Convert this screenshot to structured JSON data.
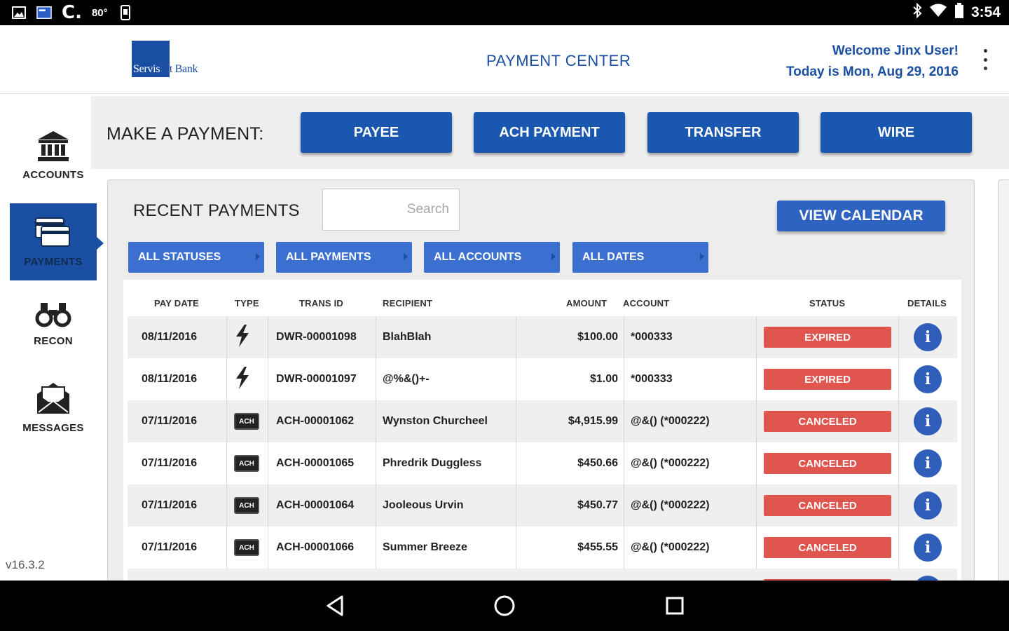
{
  "status_bar": {
    "carrier": "C.",
    "temp": "80°",
    "time": "3:54"
  },
  "header": {
    "logo": {
      "part1": "Servis",
      "part2": "1st Bank"
    },
    "title": "PAYMENT CENTER",
    "welcome": "Welcome Jinx User!",
    "date": "Today is Mon, Aug 29, 2016"
  },
  "sidebar": {
    "items": [
      {
        "label": "ACCOUNTS",
        "icon": "bank-icon"
      },
      {
        "label": "PAYMENTS",
        "icon": "payments-icon",
        "active": true
      },
      {
        "label": "RECON",
        "icon": "binoculars-icon"
      },
      {
        "label": "MESSAGES",
        "icon": "envelope-icon"
      }
    ],
    "version": "v16.3.2"
  },
  "make_payment": {
    "label": "MAKE A PAYMENT:",
    "buttons": [
      "PAYEE",
      "ACH PAYMENT",
      "TRANSFER",
      "WIRE"
    ]
  },
  "recent": {
    "title": "RECENT PAYMENTS",
    "search_placeholder": "Search",
    "view_calendar": "VIEW CALENDAR",
    "filters": [
      "ALL STATUSES",
      "ALL PAYMENTS",
      "ALL ACCOUNTS",
      "ALL DATES"
    ],
    "columns": [
      "PAY DATE",
      "TYPE",
      "TRANS ID",
      "RECIPIENT",
      "AMOUNT",
      "ACCOUNT",
      "STATUS",
      "DETAILS"
    ],
    "rows": [
      {
        "date": "08/11/2016",
        "type": "wire",
        "trans_id": "DWR-00001098",
        "recipient": "BlahBlah",
        "amount": "$100.00",
        "account": "*000333",
        "status": "EXPIRED"
      },
      {
        "date": "08/11/2016",
        "type": "wire",
        "trans_id": "DWR-00001097",
        "recipient": "@%&()+-",
        "amount": "$1.00",
        "account": "*000333",
        "status": "EXPIRED"
      },
      {
        "date": "07/11/2016",
        "type": "ACH",
        "trans_id": "ACH-00001062",
        "recipient": "Wynston Churcheel",
        "amount": "$4,915.99",
        "account": "@&() (*000222)",
        "status": "CANCELED"
      },
      {
        "date": "07/11/2016",
        "type": "ACH",
        "trans_id": "ACH-00001065",
        "recipient": "Phredrik Duggless",
        "amount": "$450.66",
        "account": "@&() (*000222)",
        "status": "CANCELED"
      },
      {
        "date": "07/11/2016",
        "type": "ACH",
        "trans_id": "ACH-00001064",
        "recipient": "Jooleous Urvin",
        "amount": "$450.77",
        "account": "@&() (*000222)",
        "status": "CANCELED"
      },
      {
        "date": "07/11/2016",
        "type": "ACH",
        "trans_id": "ACH-00001066",
        "recipient": "Summer Breeze",
        "amount": "$455.55",
        "account": "@&() (*000222)",
        "status": "CANCELED"
      }
    ],
    "info_glyph": "i"
  },
  "colors": {
    "brand": "#1a4fa3",
    "button": "#1a57b0",
    "filter": "#3b6fd0",
    "status_red": "#e0554e"
  }
}
